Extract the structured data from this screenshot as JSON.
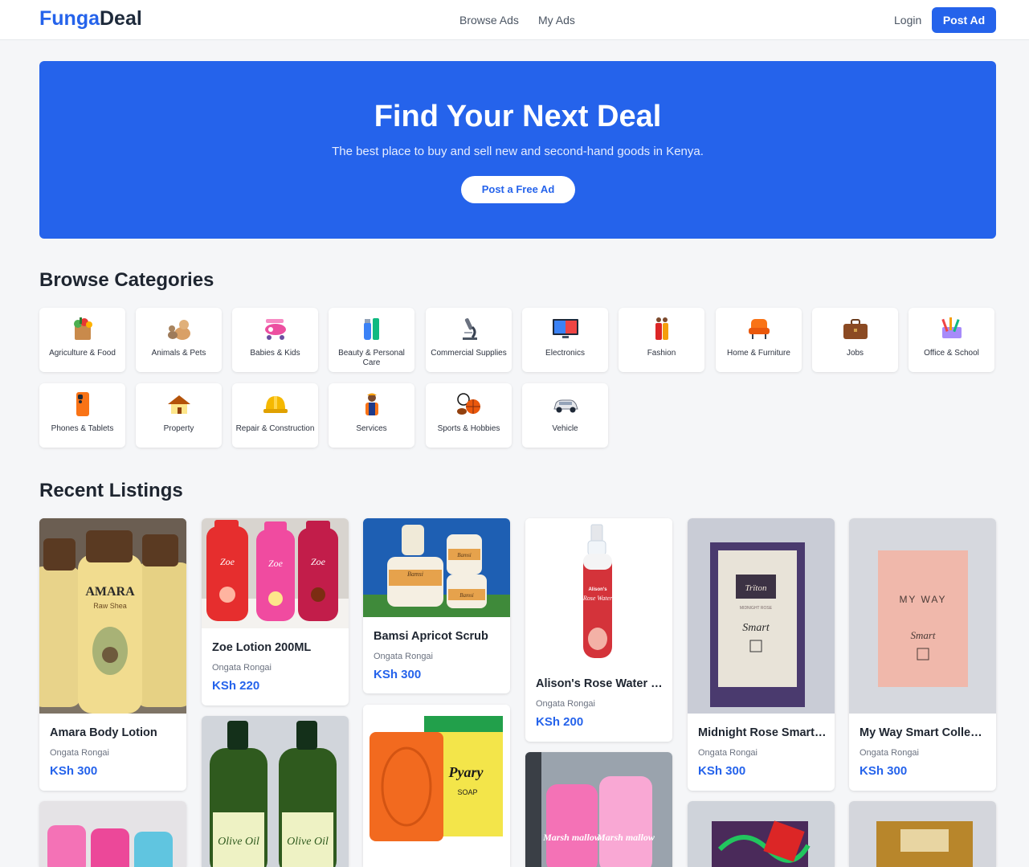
{
  "header": {
    "logo_part1": "Funga",
    "logo_part2": "Deal",
    "nav": [
      "Browse Ads",
      "My Ads"
    ],
    "login": "Login",
    "post_ad": "Post Ad"
  },
  "hero": {
    "title": "Find Your Next Deal",
    "subtitle": "The best place to buy and sell new and second-hand goods in Kenya.",
    "button": "Post a Free Ad"
  },
  "categories_title": "Browse Categories",
  "categories": [
    {
      "label": "Agriculture & Food",
      "icon": "grocery-bag-icon"
    },
    {
      "label": "Animals & Pets",
      "icon": "pets-icon"
    },
    {
      "label": "Babies & Kids",
      "icon": "toy-plane-icon"
    },
    {
      "label": "Beauty & Personal Care",
      "icon": "cosmetics-icon"
    },
    {
      "label": "Commercial Supplies",
      "icon": "microscope-icon"
    },
    {
      "label": "Electronics",
      "icon": "tv-icon"
    },
    {
      "label": "Fashion",
      "icon": "fashion-icon"
    },
    {
      "label": "Home & Furniture",
      "icon": "armchair-icon"
    },
    {
      "label": "Jobs",
      "icon": "briefcase-icon"
    },
    {
      "label": "Office & School",
      "icon": "stationery-icon"
    },
    {
      "label": "Phones & Tablets",
      "icon": "phone-icon"
    },
    {
      "label": "Property",
      "icon": "house-icon"
    },
    {
      "label": "Repair & Construction",
      "icon": "hard-hat-icon"
    },
    {
      "label": "Services",
      "icon": "worker-icon"
    },
    {
      "label": "Sports & Hobbies",
      "icon": "sports-balls-icon"
    },
    {
      "label": "Vehicle",
      "icon": "car-icon"
    }
  ],
  "listings_title": "Recent Listings",
  "listings": [
    {
      "title": "Amara Body Lotion",
      "location": "Ongata Rongai",
      "price": "KSh 300"
    },
    {
      "title": "Zoe Lotion 200ML",
      "location": "Ongata Rongai",
      "price": "KSh 220"
    },
    {
      "title": "Bamsi Apricot Scrub",
      "location": "Ongata Rongai",
      "price": "KSh 300"
    },
    {
      "title": "Alison's Rose Water Spray",
      "location": "Ongata Rongai",
      "price": "KSh 200"
    },
    {
      "title": "Midnight Rose Smart Collection",
      "location": "Ongata Rongai",
      "price": "KSh 300"
    },
    {
      "title": "My Way Smart Collection",
      "location": "Ongata Rongai",
      "price": "KSh 300"
    }
  ],
  "product_art_text": {
    "amara": "AMARA",
    "amara_sub": "Raw Shea",
    "zoe": "Zoe",
    "bamsi": "Bamsi",
    "alisons": "Alison's",
    "rose_water": "Rose Water",
    "triton": "Trïton",
    "midnight": "MIDNIGHT ROSE",
    "smart": "Smart",
    "my_way": "MY WAY",
    "olive_oil": "Olive Oil",
    "pyary": "Pyary",
    "soap": "SOAP",
    "marshmallow": "Marsh mallow"
  }
}
